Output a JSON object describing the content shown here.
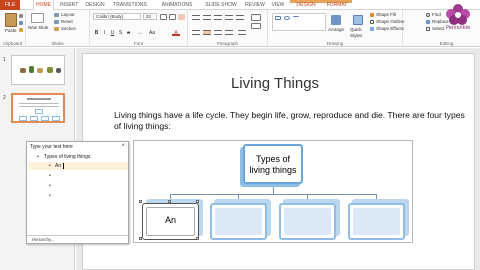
{
  "ribbon_tabs": {
    "file": "FILE",
    "home": "HOME",
    "insert": "INSERT",
    "design": "DESIGN",
    "transitions": "TRANSITIONS",
    "animations": "ANIMATIONS",
    "slideshow": "SLIDE SHOW",
    "review": "REVIEW",
    "view": "VIEW",
    "sa_design": "DESIGN",
    "format": "FORMAT"
  },
  "clipboard": {
    "paste": "Paste",
    "label": "Clipboard"
  },
  "slides_group": {
    "new_slide": "New Slide",
    "layout": "Layout",
    "reset": "Reset",
    "section": "Section",
    "label": "Slides"
  },
  "font_group": {
    "font_name": "Calibri (Body)",
    "font_size": "32",
    "label": "Font"
  },
  "paragraph_group": {
    "label": "Paragraph"
  },
  "drawing_group": {
    "arrange": "Arrange",
    "quick_styles": "Quick Styles",
    "shape_fill": "Shape Fill",
    "shape_outline": "Shape Outline",
    "shape_effects": "Shape Effects",
    "label": "Drawing"
  },
  "editing_group": {
    "find": "Find",
    "replace": "Replace",
    "select": "Select",
    "label": "Editing"
  },
  "logo": {
    "text": "Personkle"
  },
  "thumbnails": [
    {
      "number": "1"
    },
    {
      "number": "2"
    }
  ],
  "slide": {
    "title": "Living Things",
    "body": "Living things have a life cycle. They begin life, grow, reproduce and die. There are four types of living things:"
  },
  "smartart": {
    "root": "Types of living things",
    "children": [
      "An",
      "",
      "",
      ""
    ]
  },
  "text_pane": {
    "title": "Type your text here",
    "close": "×",
    "root_item": "Types of living things",
    "items": [
      "An",
      "",
      "",
      ""
    ],
    "footer": "Hierarchy..."
  },
  "colors": {
    "accent": "#c9451b",
    "smartart_border": "#6da6d5",
    "smartart_fill": "#dbe9f6"
  }
}
